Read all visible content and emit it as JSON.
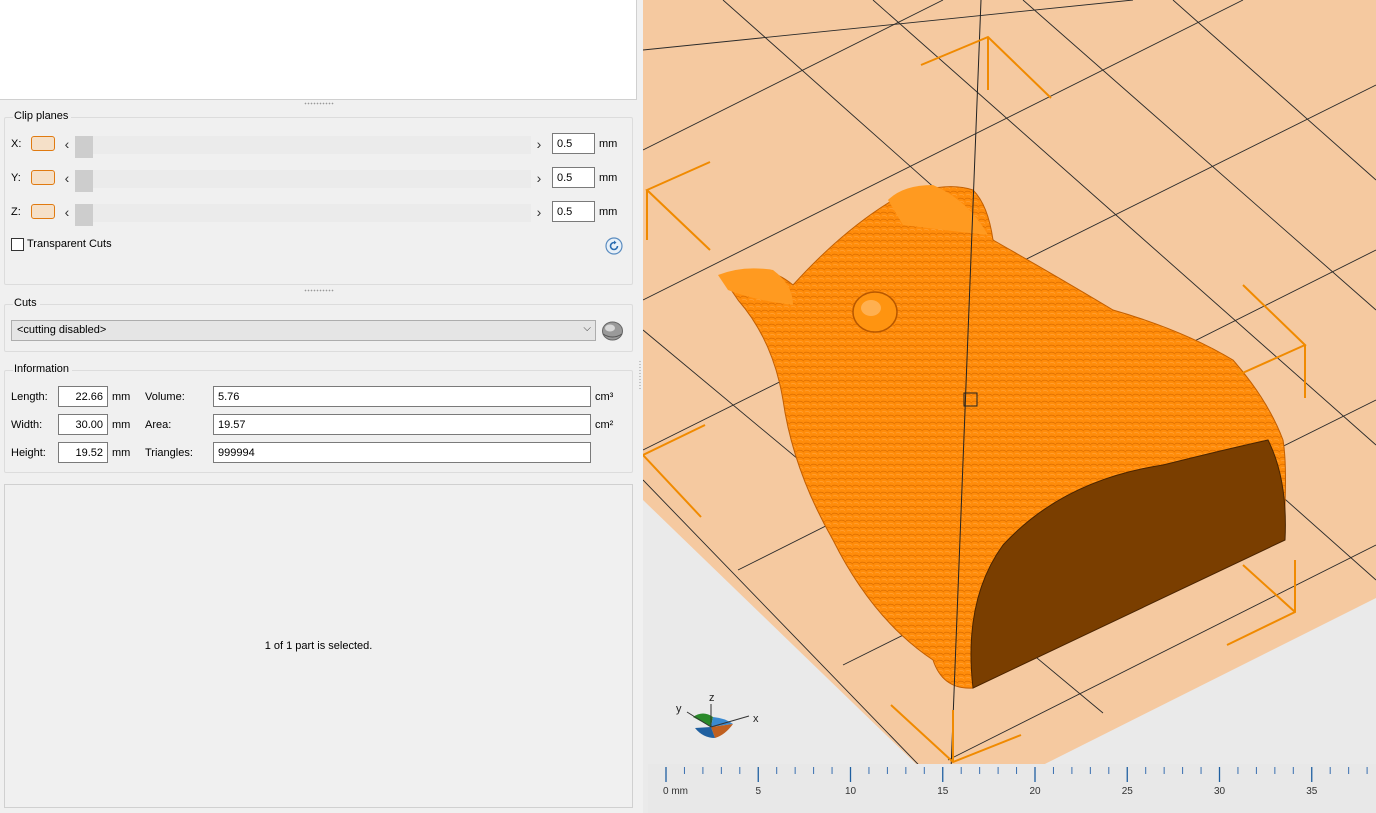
{
  "clip_planes": {
    "title": "Clip planes",
    "rows": [
      {
        "axis": "X:",
        "value": "0.5",
        "unit": "mm"
      },
      {
        "axis": "Y:",
        "value": "0.5",
        "unit": "mm"
      },
      {
        "axis": "Z:",
        "value": "0.5",
        "unit": "mm"
      }
    ],
    "transparent_cuts_label": "Transparent Cuts",
    "transparent_cuts_checked": false
  },
  "cuts": {
    "title": "Cuts",
    "selected": "<cutting disabled>"
  },
  "information": {
    "title": "Information",
    "length_label": "Length:",
    "length_value": "22.66",
    "length_unit": "mm",
    "width_label": "Width:",
    "width_value": "30.00",
    "width_unit": "mm",
    "height_label": "Height:",
    "height_value": "19.52",
    "height_unit": "mm",
    "volume_label": "Volume:",
    "volume_value": "5.76",
    "volume_unit": "cm³",
    "area_label": "Area:",
    "area_value": "19.57",
    "area_unit": "cm²",
    "triangles_label": "Triangles:",
    "triangles_value": "999994"
  },
  "selection_status": "1 of 1 part is selected.",
  "viewport": {
    "model_color": "#ff8a00",
    "cut_face_color": "#7a3e00",
    "bed_color": "#f5c9a0",
    "axes": {
      "x": "x",
      "y": "y",
      "z": "z"
    }
  },
  "ruler": {
    "labels": [
      "0 mm",
      "5",
      "10",
      "15",
      "20",
      "25",
      "30",
      "35"
    ]
  }
}
